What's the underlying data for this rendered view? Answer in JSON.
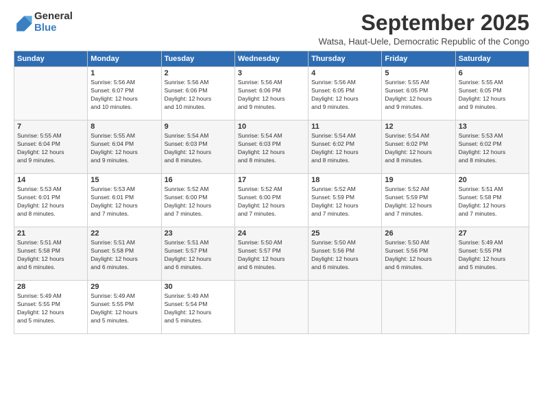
{
  "logo": {
    "general": "General",
    "blue": "Blue"
  },
  "title": "September 2025",
  "subtitle": "Watsa, Haut-Uele, Democratic Republic of the Congo",
  "days": [
    "Sunday",
    "Monday",
    "Tuesday",
    "Wednesday",
    "Thursday",
    "Friday",
    "Saturday"
  ],
  "weeks": [
    [
      {
        "day": "",
        "content": ""
      },
      {
        "day": "1",
        "content": "Sunrise: 5:56 AM\nSunset: 6:07 PM\nDaylight: 12 hours\nand 10 minutes."
      },
      {
        "day": "2",
        "content": "Sunrise: 5:56 AM\nSunset: 6:06 PM\nDaylight: 12 hours\nand 10 minutes."
      },
      {
        "day": "3",
        "content": "Sunrise: 5:56 AM\nSunset: 6:06 PM\nDaylight: 12 hours\nand 9 minutes."
      },
      {
        "day": "4",
        "content": "Sunrise: 5:56 AM\nSunset: 6:05 PM\nDaylight: 12 hours\nand 9 minutes."
      },
      {
        "day": "5",
        "content": "Sunrise: 5:55 AM\nSunset: 6:05 PM\nDaylight: 12 hours\nand 9 minutes."
      },
      {
        "day": "6",
        "content": "Sunrise: 5:55 AM\nSunset: 6:05 PM\nDaylight: 12 hours\nand 9 minutes."
      }
    ],
    [
      {
        "day": "7",
        "content": "Sunrise: 5:55 AM\nSunset: 6:04 PM\nDaylight: 12 hours\nand 9 minutes."
      },
      {
        "day": "8",
        "content": "Sunrise: 5:55 AM\nSunset: 6:04 PM\nDaylight: 12 hours\nand 9 minutes."
      },
      {
        "day": "9",
        "content": "Sunrise: 5:54 AM\nSunset: 6:03 PM\nDaylight: 12 hours\nand 8 minutes."
      },
      {
        "day": "10",
        "content": "Sunrise: 5:54 AM\nSunset: 6:03 PM\nDaylight: 12 hours\nand 8 minutes."
      },
      {
        "day": "11",
        "content": "Sunrise: 5:54 AM\nSunset: 6:02 PM\nDaylight: 12 hours\nand 8 minutes."
      },
      {
        "day": "12",
        "content": "Sunrise: 5:54 AM\nSunset: 6:02 PM\nDaylight: 12 hours\nand 8 minutes."
      },
      {
        "day": "13",
        "content": "Sunrise: 5:53 AM\nSunset: 6:02 PM\nDaylight: 12 hours\nand 8 minutes."
      }
    ],
    [
      {
        "day": "14",
        "content": "Sunrise: 5:53 AM\nSunset: 6:01 PM\nDaylight: 12 hours\nand 8 minutes."
      },
      {
        "day": "15",
        "content": "Sunrise: 5:53 AM\nSunset: 6:01 PM\nDaylight: 12 hours\nand 7 minutes."
      },
      {
        "day": "16",
        "content": "Sunrise: 5:52 AM\nSunset: 6:00 PM\nDaylight: 12 hours\nand 7 minutes."
      },
      {
        "day": "17",
        "content": "Sunrise: 5:52 AM\nSunset: 6:00 PM\nDaylight: 12 hours\nand 7 minutes."
      },
      {
        "day": "18",
        "content": "Sunrise: 5:52 AM\nSunset: 5:59 PM\nDaylight: 12 hours\nand 7 minutes."
      },
      {
        "day": "19",
        "content": "Sunrise: 5:52 AM\nSunset: 5:59 PM\nDaylight: 12 hours\nand 7 minutes."
      },
      {
        "day": "20",
        "content": "Sunrise: 5:51 AM\nSunset: 5:58 PM\nDaylight: 12 hours\nand 7 minutes."
      }
    ],
    [
      {
        "day": "21",
        "content": "Sunrise: 5:51 AM\nSunset: 5:58 PM\nDaylight: 12 hours\nand 6 minutes."
      },
      {
        "day": "22",
        "content": "Sunrise: 5:51 AM\nSunset: 5:58 PM\nDaylight: 12 hours\nand 6 minutes."
      },
      {
        "day": "23",
        "content": "Sunrise: 5:51 AM\nSunset: 5:57 PM\nDaylight: 12 hours\nand 6 minutes."
      },
      {
        "day": "24",
        "content": "Sunrise: 5:50 AM\nSunset: 5:57 PM\nDaylight: 12 hours\nand 6 minutes."
      },
      {
        "day": "25",
        "content": "Sunrise: 5:50 AM\nSunset: 5:56 PM\nDaylight: 12 hours\nand 6 minutes."
      },
      {
        "day": "26",
        "content": "Sunrise: 5:50 AM\nSunset: 5:56 PM\nDaylight: 12 hours\nand 6 minutes."
      },
      {
        "day": "27",
        "content": "Sunrise: 5:49 AM\nSunset: 5:55 PM\nDaylight: 12 hours\nand 5 minutes."
      }
    ],
    [
      {
        "day": "28",
        "content": "Sunrise: 5:49 AM\nSunset: 5:55 PM\nDaylight: 12 hours\nand 5 minutes."
      },
      {
        "day": "29",
        "content": "Sunrise: 5:49 AM\nSunset: 5:55 PM\nDaylight: 12 hours\nand 5 minutes."
      },
      {
        "day": "30",
        "content": "Sunrise: 5:49 AM\nSunset: 5:54 PM\nDaylight: 12 hours\nand 5 minutes."
      },
      {
        "day": "",
        "content": ""
      },
      {
        "day": "",
        "content": ""
      },
      {
        "day": "",
        "content": ""
      },
      {
        "day": "",
        "content": ""
      }
    ]
  ]
}
